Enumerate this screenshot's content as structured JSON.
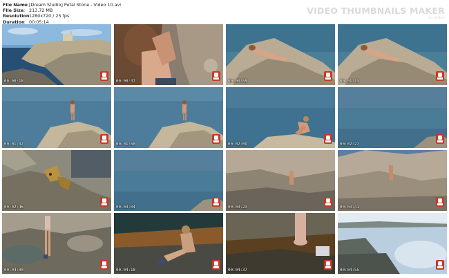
{
  "info": {
    "rows": [
      {
        "key": "File Name",
        "value": "[Dream Studio] Petal Stone - Video 10.avi"
      },
      {
        "key": "File Size",
        "value": "213.72 MB"
      },
      {
        "key": "Resolution",
        "value": "1280x720 / 25 fps"
      },
      {
        "key": "Duration",
        "value": "00:05:14"
      }
    ],
    "separator": ":"
  },
  "brand": {
    "title": "VIDEO THUMBNAILS MAKER",
    "subtitle": "by Video"
  },
  "thumbnails": [
    {
      "time": "00:00:18",
      "scene": "coast"
    },
    {
      "time": "00:00:37",
      "scene": "closeup"
    },
    {
      "time": "00:00:55",
      "scene": "rock-lying"
    },
    {
      "time": "00:01:13",
      "scene": "rock-lying"
    },
    {
      "time": "00:01:32",
      "scene": "sea-rock-standing"
    },
    {
      "time": "00:01:50",
      "scene": "sea-rock-standing"
    },
    {
      "time": "00:02:09",
      "scene": "sea-rock-sitting"
    },
    {
      "time": "00:02:27",
      "scene": "sea-plain"
    },
    {
      "time": "00:02:46",
      "scene": "butterfly"
    },
    {
      "time": "00:03:04",
      "scene": "sea-plain"
    },
    {
      "time": "00:03:23",
      "scene": "rocky-cliffs"
    },
    {
      "time": "00:03:41",
      "scene": "rocky-cliffs-2"
    },
    {
      "time": "00:04:00",
      "scene": "rocks-walking"
    },
    {
      "time": "00:04:18",
      "scene": "sitting-rock"
    },
    {
      "time": "00:04:37",
      "scene": "feet-pool"
    },
    {
      "time": "00:04:55",
      "scene": "bay"
    }
  ]
}
